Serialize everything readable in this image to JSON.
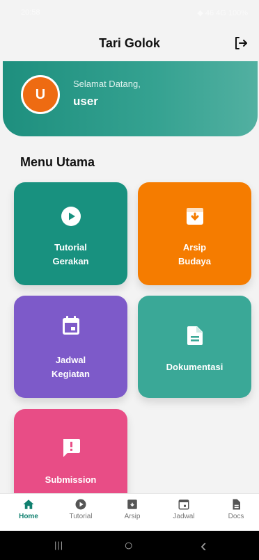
{
  "status_bar": {
    "time": "20:58",
    "right": "◆ 46 4G 100%"
  },
  "appbar": {
    "title": "Tari Golok",
    "logout_icon": "logout-icon"
  },
  "welcome": {
    "avatar_letter": "U",
    "greeting": "Selamat Datang,",
    "username": "user"
  },
  "menu": {
    "title": "Menu Utama",
    "items": [
      {
        "label_line1": "Tutorial",
        "label_line2": "Gerakan",
        "icon": "play-icon",
        "color": "#18917f"
      },
      {
        "label_line1": "Arsip",
        "label_line2": "Budaya",
        "icon": "archive-icon",
        "color": "#f57c00"
      },
      {
        "label_line1": "Jadwal",
        "label_line2": "Kegiatan",
        "icon": "calendar-icon",
        "color": "#7d5ac9"
      },
      {
        "label_line1": "Dokumentasi",
        "label_line2": "",
        "icon": "document-icon",
        "color": "#3aa897"
      },
      {
        "label_line1": "Submission",
        "label_line2": "",
        "icon": "feedback-icon",
        "color": "#e84d86"
      }
    ]
  },
  "bottom_nav": {
    "items": [
      {
        "label": "Home",
        "icon": "home-icon",
        "active": true
      },
      {
        "label": "Tutorial",
        "icon": "play-icon",
        "active": false
      },
      {
        "label": "Arsip",
        "icon": "archive-icon",
        "active": false
      },
      {
        "label": "Jadwal",
        "icon": "calendar-icon",
        "active": false
      },
      {
        "label": "Docs",
        "icon": "document-icon",
        "active": false
      }
    ],
    "active_color": "#10806f"
  },
  "system_nav": {
    "recents": "|||",
    "home": "○",
    "back": "‹"
  }
}
